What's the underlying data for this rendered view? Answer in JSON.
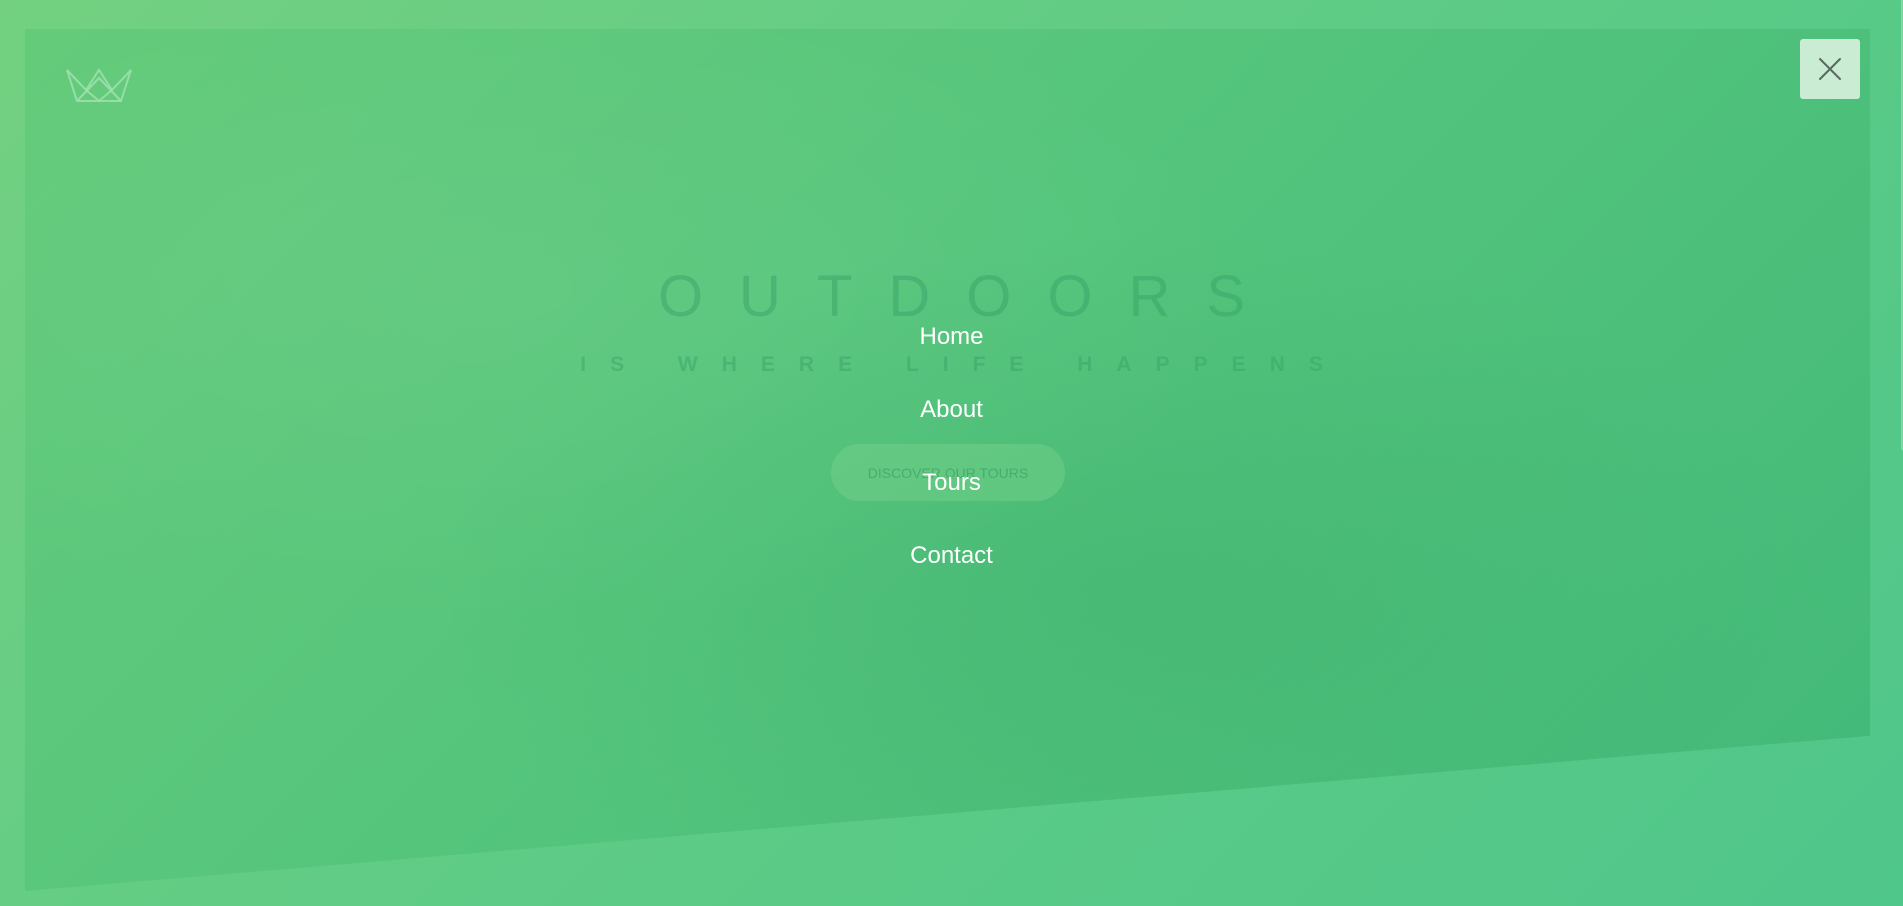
{
  "hero": {
    "title": "OUTDOORS",
    "subtitle": "IS WHERE LIFE HAPPENS",
    "cta_label": "DISCOVER OUR TOURS"
  },
  "logo": {
    "icon": "crown-icon"
  },
  "close": {
    "icon": "close-icon"
  },
  "navigation": {
    "items": [
      {
        "label": "Home"
      },
      {
        "label": "About"
      },
      {
        "label": "Tours"
      },
      {
        "label": "Contact"
      }
    ]
  },
  "colors": {
    "overlay": "#5ccb86",
    "hero": "#55c57c",
    "close_button_bg": "#c9ecd3",
    "nav_text": "#ffffff"
  }
}
